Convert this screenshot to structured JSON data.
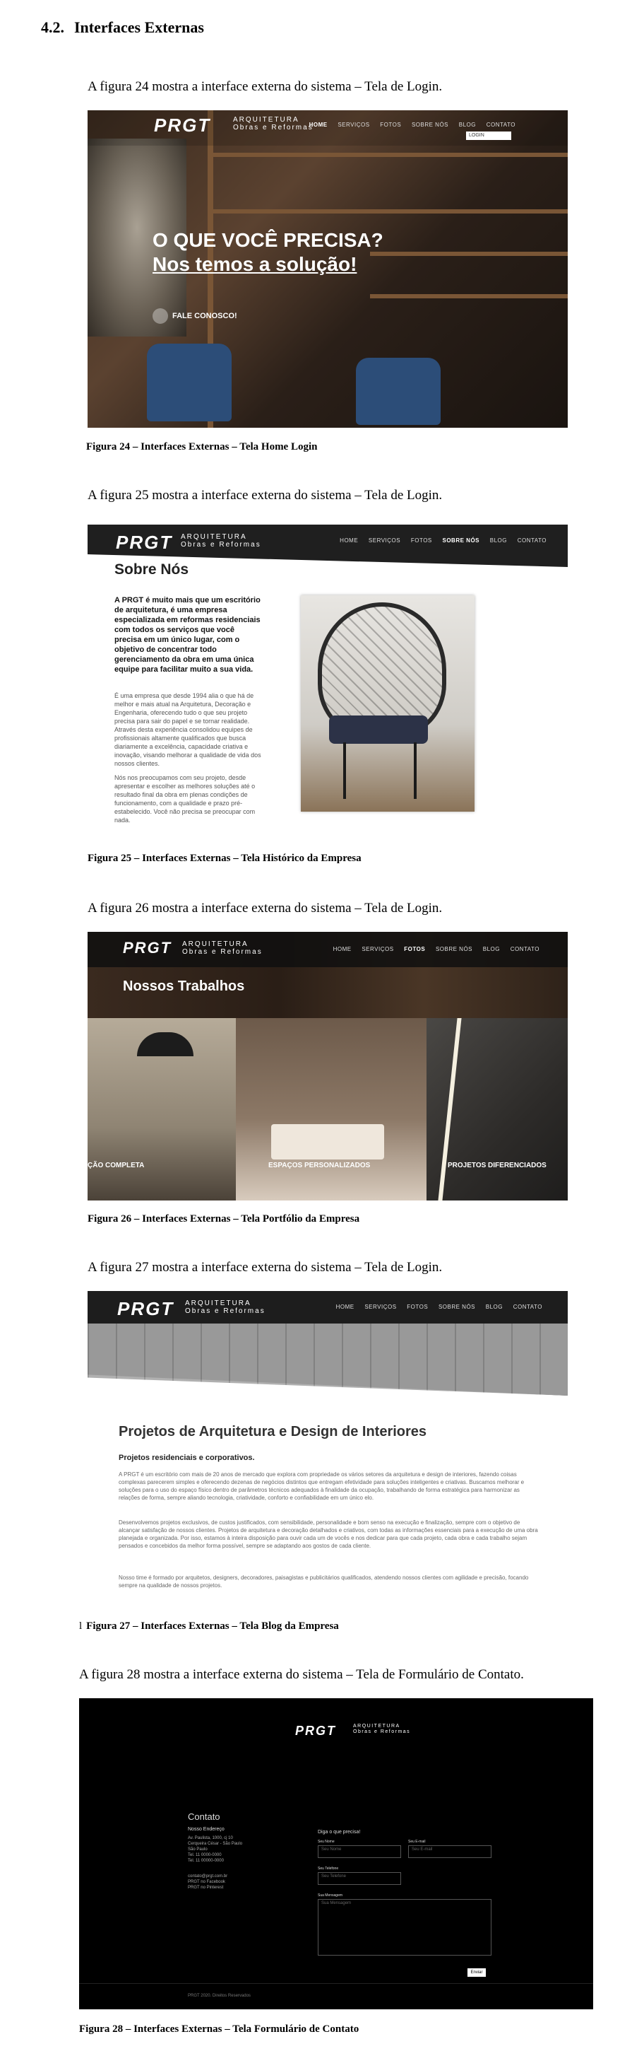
{
  "section": {
    "number": "4.2.",
    "title": "Interfaces Externas"
  },
  "figures": [
    {
      "intro": "A figura 24 mostra a interface externa do sistema – Tela de Login.",
      "caption": "Figura 24 – Interfaces Externas – Tela Home Login",
      "screen": {
        "logo": "PRGT",
        "logo_sub1": "ARQUITETURA",
        "logo_sub2": "Obras e Reformas",
        "menu": [
          "HOME",
          "SERVIÇOS",
          "FOTOS",
          "SOBRE NÓS",
          "BLOG",
          "CONTATO"
        ],
        "search_placeholder": "LOGIN",
        "hero_line1": "O QUE VOCÊ PRECISA?",
        "hero_line2": "Nos temos a solução!",
        "cta": "FALE CONOSCO!"
      }
    },
    {
      "intro": "A figura 25 mostra a interface externa do sistema – Tela de Login.",
      "caption": "Figura 25 – Interfaces Externas – Tela Histórico da Empresa",
      "screen": {
        "logo": "PRGT",
        "logo_sub1": "ARQUITETURA",
        "logo_sub2": "Obras e Reformas",
        "menu": [
          "HOME",
          "SERVIÇOS",
          "FOTOS",
          "SOBRE NÓS",
          "BLOG",
          "CONTATO"
        ],
        "heading": "Sobre Nós",
        "lead": "A PRGT é muito mais que um escritório de arquitetura, é uma empresa especializada em reformas residenciais com todos os serviços que você precisa em um único lugar, com o objetivo de concentrar todo gerenciamento da obra em uma única equipe para facilitar muito a sua vida.",
        "body1": "É uma empresa que desde 1994 alia o que há de melhor e mais atual na Arquitetura, Decoração e Engenharia, oferecendo tudo o que seu projeto precisa para sair do papel e se tornar realidade. Através desta experiência consolidou equipes de profissionais altamente qualificados que busca diariamente a excelência, capacidade criativa e inovação, visando melhorar a qualidade de vida dos nossos clientes.",
        "body2": "Nós nos preocupamos com seu projeto, desde apresentar e escolher as melhores soluções até o resultado final da obra em plenas condições de funcionamento, com a qualidade e prazo pré-estabelecido. Você não precisa se preocupar com nada."
      }
    },
    {
      "intro": "A figura 26 mostra a interface externa do sistema – Tela de Login.",
      "caption": "Figura 26 – Interfaces Externas – Tela Portfólio da Empresa",
      "screen": {
        "logo": "PRGT",
        "logo_sub1": "ARQUITETURA",
        "logo_sub2": "Obras e Reformas",
        "menu": [
          "HOME",
          "SERVIÇOS",
          "FOTOS",
          "SOBRE NÓS",
          "BLOG",
          "CONTATO"
        ],
        "heading": "Nossos Trabalhos",
        "tiles": [
          "ÇÃO COMPLETA",
          "ESPAÇOS PERSONALIZADOS",
          "PROJETOS DIFERENCIADOS"
        ]
      }
    },
    {
      "intro": "A figura 27 mostra a interface externa do sistema – Tela de Login.",
      "caption": "Figura 27 – Interfaces Externas – Tela Blog da Empresa",
      "caption_prefix": "l",
      "screen": {
        "logo": "PRGT",
        "logo_sub1": "ARQUITETURA",
        "logo_sub2": "Obras e Reformas",
        "menu": [
          "HOME",
          "SERVIÇOS",
          "FOTOS",
          "SOBRE NÓS",
          "BLOG",
          "CONTATO"
        ],
        "heading": "Projetos de Arquitetura e Design de Interiores",
        "subheading": "Projetos residenciais e corporativos.",
        "p1": "A PRGT é um escritório com mais de 20 anos de mercado que explora com propriedade os vários setores da arquitetura e design de interiores, fazendo coisas complexas parecerem simples e oferecendo dezenas de negócios distintos que entregam efetividade para soluções inteligentes e criativas. Buscamos melhorar e soluções para o uso do espaço físico dentro de parâmetros técnicos adequados à finalidade da ocupação, trabalhando de forma estratégica para harmonizar as relações de forma, sempre aliando tecnologia, criatividade, conforto e confiabilidade em um único elo.",
        "p2": "Desenvolvemos projetos exclusivos, de custos justificados, com sensibilidade, personalidade e bom senso na execução e finalização, sempre com o objetivo de alcançar satisfação de nossos clientes. Projetos de arquitetura e decoração detalhados e criativos, com todas as informações essenciais para a execução de uma obra planejada e organizada. Por isso, estamos à inteira disposição para ouvir cada um de vocês e nos dedicar para que cada projeto, cada obra e cada trabalho sejam pensados e concebidos da melhor forma possível, sempre se adaptando aos gostos de cada cliente.",
        "p3": "Nosso time é formado por arquitetos, designers, decoradores, paisagistas e publicitários qualificados, atendendo nossos clientes com agilidade e precisão, focando sempre na qualidade de nossos projetos."
      }
    },
    {
      "intro": "A figura 28 mostra a interface externa do sistema – Tela de Formulário de Contato.",
      "caption": "Figura 28 – Interfaces Externas – Tela Formulário de Contato",
      "screen": {
        "logo": "PRGT",
        "logo_sub1": "ARQUITETURA",
        "logo_sub2": "Obras e Reformas",
        "contact_title": "Contato",
        "address_title": "Nosso Endereço",
        "address_lines": [
          "Av. Paulista, 1000, cj 10",
          "Cerqueira César - São Paulo",
          "São Paulo",
          "Tel. 11 0000-0000",
          "Tel. 11 00000-0000"
        ],
        "social_lines": [
          "contato@prgt.com.br",
          "PRGT no Facebook",
          "PRGT no Pinterest"
        ],
        "form_title": "Diga o que precisa!",
        "label_name": "Seu Nome",
        "ph_name": "Seu Nome",
        "label_email": "Seu E-mail",
        "ph_email": "Seu E-mail",
        "label_phone": "Seu Telefone",
        "ph_phone": "Seu Telefone",
        "label_msg": "Sua Mensagem",
        "ph_msg": "Sua Mensagem",
        "submit": "Enviar",
        "footer": "PRGT 2020. Direitos Reservados"
      }
    }
  ]
}
